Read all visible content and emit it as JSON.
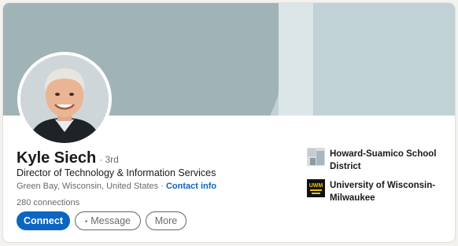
{
  "profile": {
    "name": "Kyle Siech",
    "degree": "· 3rd",
    "headline": "Director of Technology & Information Services",
    "location": "Green Bay, Wisconsin, United States",
    "separator": "·",
    "contact_info": "Contact info",
    "connections": "280 connections"
  },
  "actions": {
    "connect": "Connect",
    "message": "Message",
    "more": "More"
  },
  "organizations": [
    {
      "name": "Howard-Suamico School District",
      "logo_icon": "school-district-logo"
    },
    {
      "name": "University of Wisconsin-Milwaukee",
      "logo_icon": "uwm-logo",
      "logo_text": "UWM"
    }
  ],
  "colors": {
    "accent": "#0a66c2",
    "banner": "#a0b4b7"
  }
}
